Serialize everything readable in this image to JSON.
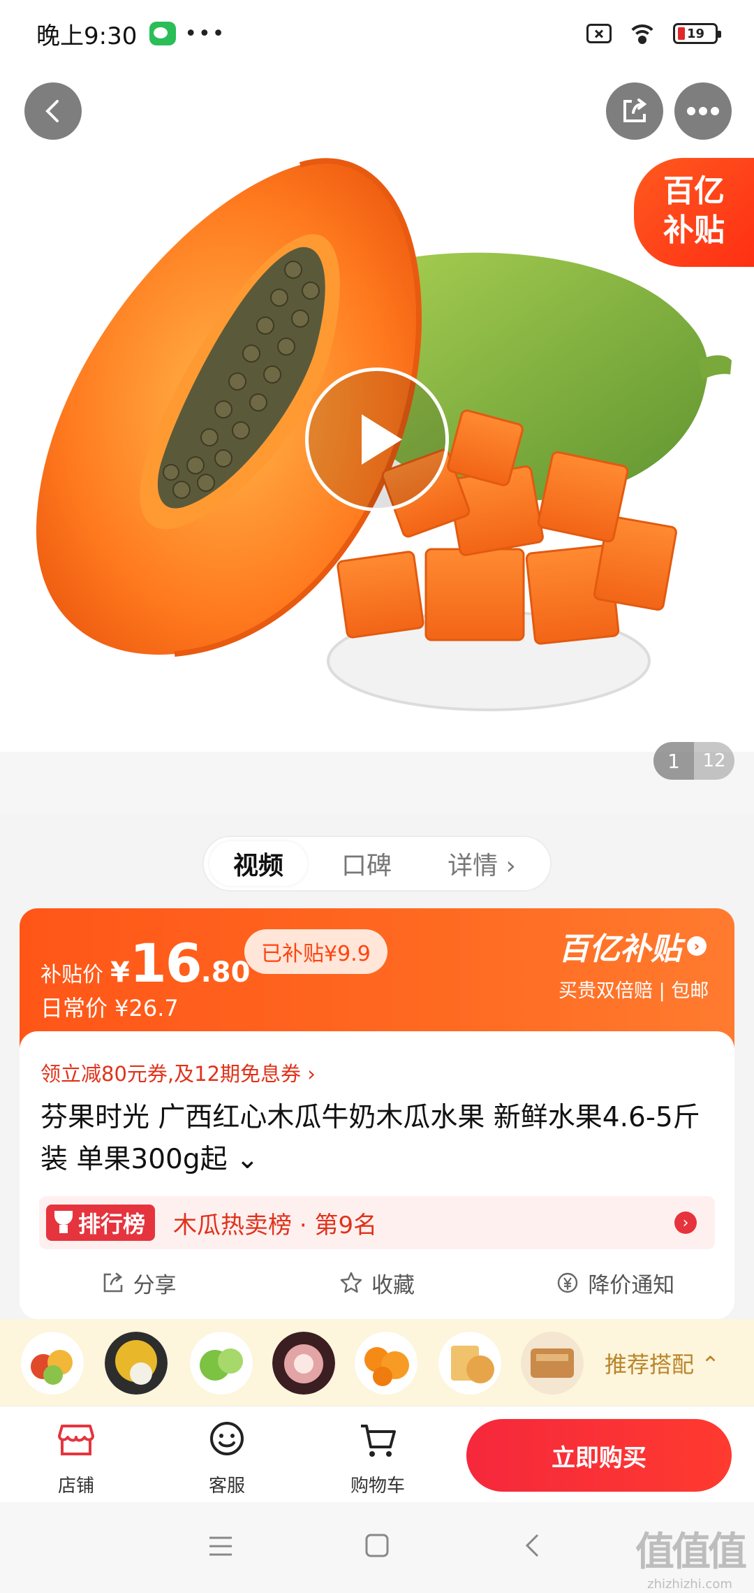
{
  "status": {
    "time": "晚上9:30",
    "dots": "•••",
    "battery": "19"
  },
  "hero": {
    "badge_line1": "百亿",
    "badge_line2": "补贴",
    "page_current": "1",
    "page_total": "12"
  },
  "tabs": [
    {
      "label": "视频",
      "active": true
    },
    {
      "label": "口碑",
      "active": false
    },
    {
      "label": "详情 ›",
      "active": false
    }
  ],
  "price": {
    "label": "补贴价",
    "yen": "¥",
    "integer": "16",
    "decimal": ".80",
    "subsidy": "已补贴¥9.9",
    "regular": "日常价 ¥26.7",
    "program_logo": "百亿补贴",
    "program_tags": "买贵双倍赔 | 包邮"
  },
  "product": {
    "coupon": "领立减80元券,及12期免息券 ›",
    "title": "芬果时光 广西红心木瓜牛奶木瓜水果 新鲜水果4.6-5斤装 单果300g起 ⌄",
    "rank_badge": "排行榜",
    "rank_text": "木瓜热卖榜 · 第9名",
    "rank_arrow": "›"
  },
  "actions": [
    {
      "label": "分享",
      "icon": "share-icon"
    },
    {
      "label": "收藏",
      "icon": "star-icon"
    },
    {
      "label": "降价通知",
      "icon": "yen-bell-icon"
    }
  ],
  "recommend": {
    "label": "推荐搭配 ⌃"
  },
  "bottom_nav": [
    {
      "label": "店铺",
      "icon": "store-icon"
    },
    {
      "label": "客服",
      "icon": "chat-icon"
    },
    {
      "label": "购物车",
      "icon": "cart-icon"
    }
  ],
  "buy_button": "立即购买",
  "watermark": {
    "big": "值值值",
    "small": "zhizhizhi.com"
  },
  "colors": {
    "accent": "#ff5618",
    "buy": "#f5283c",
    "coupon_red": "#e0321a",
    "recommend_bg": "#fdf5dc"
  }
}
